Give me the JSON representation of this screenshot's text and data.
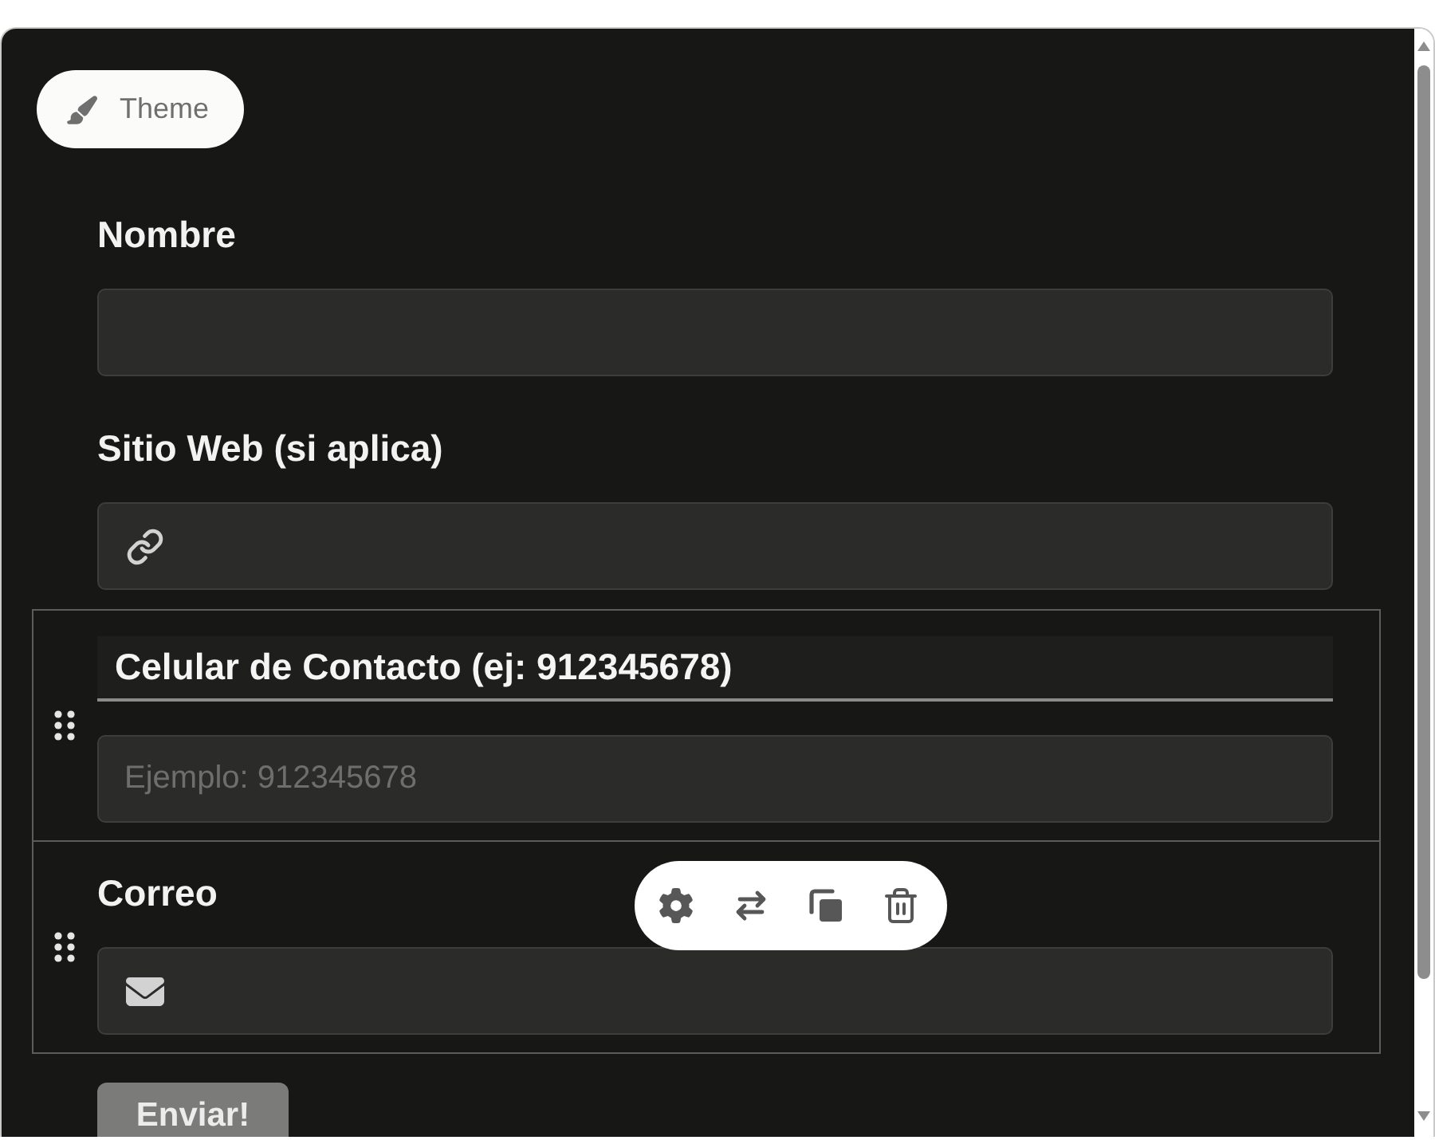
{
  "theme_button": {
    "label": "Theme"
  },
  "fields": [
    {
      "kind": "text",
      "label": "Nombre",
      "selected": false,
      "hovered": false
    },
    {
      "kind": "url",
      "label": "Sitio Web (si aplica)",
      "selected": false,
      "hovered": false
    },
    {
      "kind": "phone",
      "label": "Celular de Contacto (ej: 912345678)",
      "placeholder": "Ejemplo: 912345678",
      "selected": true,
      "hovered": false
    },
    {
      "kind": "email",
      "label": "Correo",
      "selected": false,
      "hovered": true
    }
  ],
  "submit_button": {
    "label": "Enviar!"
  }
}
